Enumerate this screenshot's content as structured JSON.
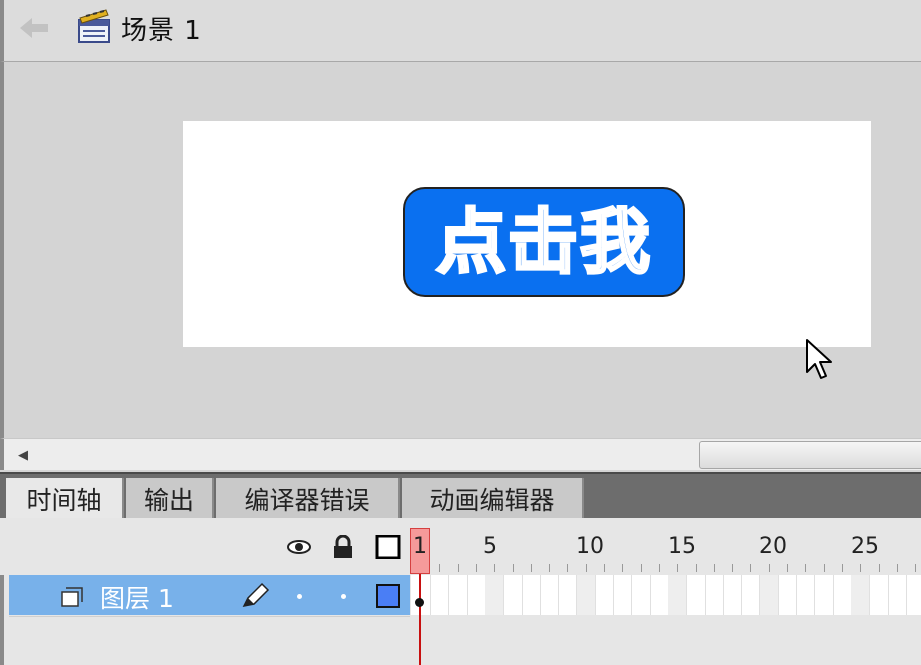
{
  "breadcrumb": {
    "scene_label": "场景 1"
  },
  "stage": {
    "button_text": "点击我"
  },
  "panel_tabs": [
    {
      "label": "时间轴",
      "active": true
    },
    {
      "label": "输出",
      "active": false
    },
    {
      "label": "编译器错误",
      "active": false
    },
    {
      "label": "动画编辑器",
      "active": false
    }
  ],
  "timeline": {
    "ruler_labels": [
      "1",
      "5",
      "10",
      "15",
      "20",
      "25"
    ],
    "current_frame": "1",
    "layer": {
      "name": "图层 1"
    }
  },
  "icons": {
    "back": "back-arrow-icon",
    "scene": "clapperboard-icon",
    "eye": "eye-icon",
    "lock": "lock-icon",
    "outline": "outline-square-icon",
    "layer": "layer-icon",
    "pencil": "pencil-icon"
  },
  "colors": {
    "button_fill": "#0a70f0",
    "layer_selected": "#78b1ea",
    "playhead": "#c81010",
    "layer_color_box": "#4a7ef5"
  }
}
